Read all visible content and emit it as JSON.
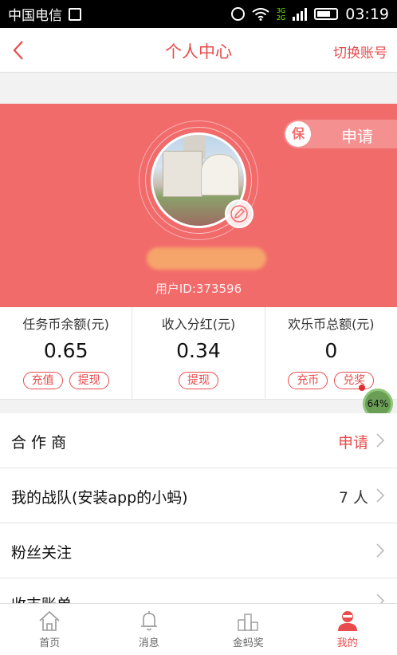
{
  "status_bar": {
    "carrier": "中国电信",
    "network_type_top": "3G",
    "network_type_bottom": "2G",
    "time": "03:19"
  },
  "header": {
    "title": "个人中心",
    "switch_account": "切换账号"
  },
  "profile": {
    "apply_badge": "保",
    "apply_label": "申请",
    "user_id": "用户ID:373596"
  },
  "stats": [
    {
      "label": "任务币余额(元)",
      "value": "0.65",
      "buttons": [
        "充值",
        "提现"
      ]
    },
    {
      "label": "收入分红(元)",
      "value": "0.34",
      "buttons": [
        "提现"
      ]
    },
    {
      "label": "欢乐币总额(元)",
      "value": "0",
      "buttons": [
        "充币",
        "兑奖"
      ]
    }
  ],
  "overlay": {
    "progress_percent": "64%"
  },
  "menu": [
    {
      "label": "合 作 商",
      "value": "申请"
    },
    {
      "label": "我的战队(安装app的小蚂)",
      "value": "7 人"
    },
    {
      "label": "粉丝关注",
      "value": ""
    },
    {
      "label": "收支账单",
      "value": ""
    }
  ],
  "tabbar": [
    {
      "label": "首页",
      "icon": "home-icon"
    },
    {
      "label": "消息",
      "icon": "bell-icon"
    },
    {
      "label": "金蚂奖",
      "icon": "podium-icon"
    },
    {
      "label": "我的",
      "icon": "user-icon",
      "active": true
    }
  ],
  "colors": {
    "accent": "#e84c4c",
    "profile_bg": "#f26b6b"
  }
}
